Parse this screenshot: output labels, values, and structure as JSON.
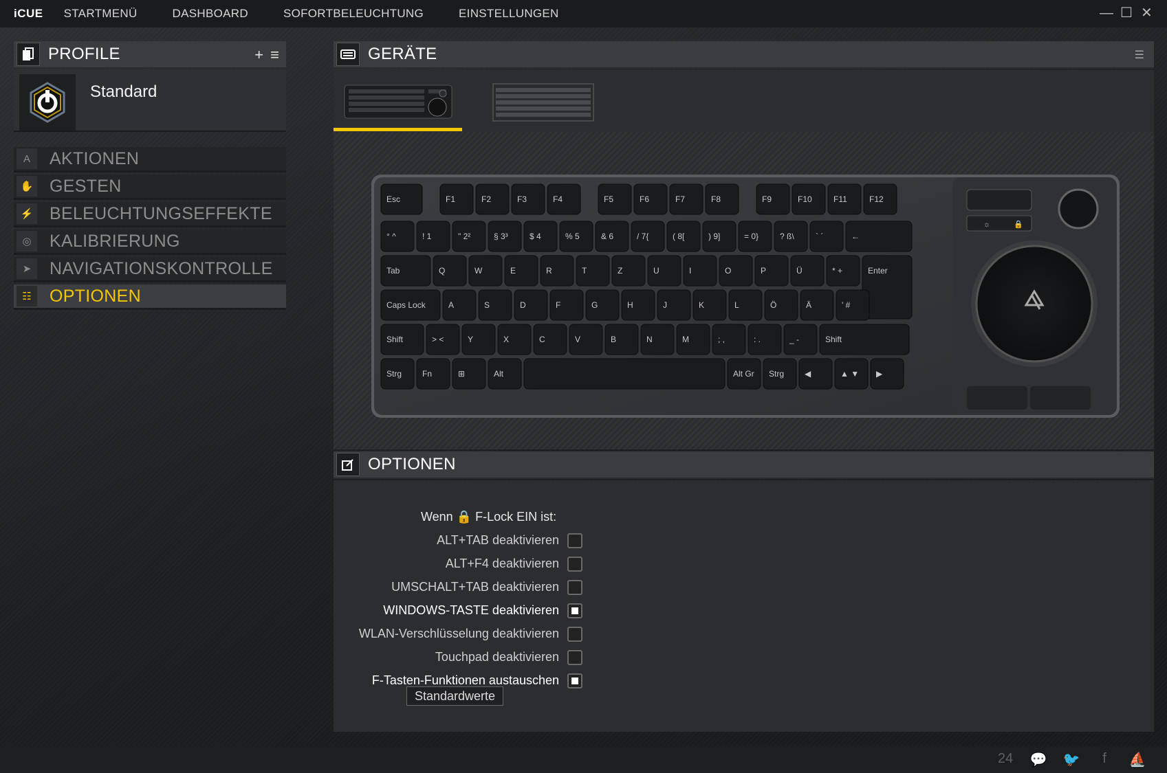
{
  "app": {
    "logo": "iCUE"
  },
  "topmenu": [
    "STARTMENÜ",
    "DASHBOARD",
    "SOFORTBELEUCHTUNG",
    "EINSTELLUNGEN"
  ],
  "window_controls": {
    "minimize": "—",
    "maximize": "☐",
    "close": "✕"
  },
  "profile": {
    "title": "PROFILE",
    "add": "+",
    "menu": "≡",
    "name": "Standard"
  },
  "nav": [
    {
      "label": "AKTIONEN",
      "icon": "A",
      "active": false
    },
    {
      "label": "GESTEN",
      "icon": "✋",
      "active": false
    },
    {
      "label": "BELEUCHTUNGSEFFEKTE",
      "icon": "⚡",
      "active": false
    },
    {
      "label": "KALIBRIERUNG",
      "icon": "◎",
      "active": false
    },
    {
      "label": "NAVIGATIONSKONTROLLE",
      "icon": "➤",
      "active": false
    },
    {
      "label": "OPTIONEN",
      "icon": "☷",
      "active": true
    }
  ],
  "devices": {
    "title": "GERÄTE"
  },
  "keyboard": {
    "row0": [
      "Esc",
      "F1",
      "F2",
      "F3",
      "F4",
      "F5",
      "F6",
      "F7",
      "F8",
      "F9",
      "F10",
      "F11",
      "F12"
    ],
    "row1": [
      "° ^",
      "! 1",
      "\" 2²",
      "§ 3³",
      "$ 4",
      "% 5",
      "& 6",
      "/ 7{",
      "( 8[",
      ") 9]",
      "= 0}",
      "? ß\\",
      "` ´",
      "←"
    ],
    "row2": [
      "Tab",
      "Q",
      "W",
      "E",
      "R",
      "T",
      "Z",
      "U",
      "I",
      "O",
      "P",
      "Ü",
      "* +",
      "Enter"
    ],
    "row3": [
      "Caps Lock",
      "A",
      "S",
      "D",
      "F",
      "G",
      "H",
      "J",
      "K",
      "L",
      "Ö",
      "Ä",
      "' #"
    ],
    "row4": [
      "Shift",
      "> <",
      "Y",
      "X",
      "C",
      "V",
      "B",
      "N",
      "M",
      "; ,",
      ": .",
      "_ -",
      "Shift"
    ],
    "row5": [
      "Strg",
      "Fn",
      "⊞",
      "Alt",
      "",
      "Alt Gr",
      "Strg",
      "◀",
      "▲ ▼",
      "▶"
    ]
  },
  "options": {
    "title": "OPTIONEN",
    "flock_prefix": "Wenn",
    "flock_suffix": "F-Lock EIN ist:",
    "items": [
      {
        "label": "ALT+TAB deaktivieren",
        "checked": false
      },
      {
        "label": "ALT+F4 deaktivieren",
        "checked": false
      },
      {
        "label": "UMSCHALT+TAB deaktivieren",
        "checked": false
      },
      {
        "label": "WINDOWS-TASTE deaktivieren",
        "checked": true
      },
      {
        "label": "WLAN-Verschlüsselung deaktivieren",
        "checked": false
      },
      {
        "label": "Touchpad deaktivieren",
        "checked": false
      },
      {
        "label": "F-Tasten-Funktionen austauschen",
        "checked": true
      }
    ],
    "tooltip": "Standardwerte"
  },
  "footer": [
    "24",
    "💬",
    "🐦",
    "f",
    "⛵"
  ],
  "colors": {
    "accent": "#f4c700",
    "panel": "#3a3c3f",
    "background": "#202224"
  }
}
